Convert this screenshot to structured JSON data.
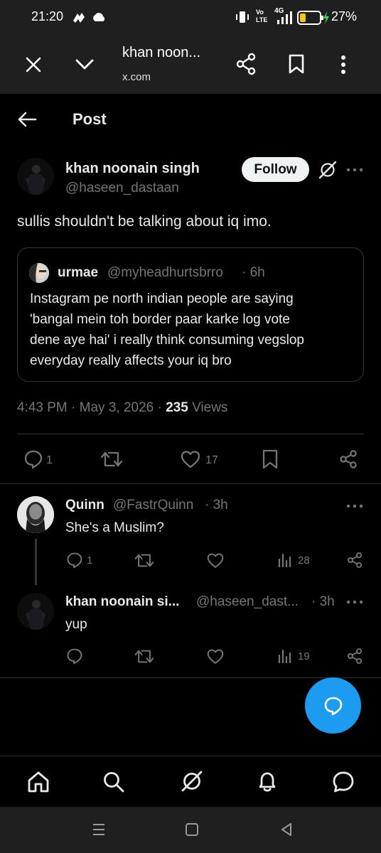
{
  "status_bar": {
    "time": "21:20",
    "battery_pct": "27%",
    "network": "4G",
    "volte": "Vo LTE"
  },
  "browser": {
    "page_title": "khan noon...",
    "url": "x.com"
  },
  "header": {
    "title": "Post"
  },
  "post": {
    "author_name": "khan noonain singh",
    "author_handle": "@haseen_dastaan",
    "follow_label": "Follow",
    "text": "sullis shouldn't be talking about iq imo.",
    "quote": {
      "author_name": "urmae",
      "author_handle": "@myheadhurtsbrro",
      "time": "· 6h",
      "lines": [
        "Instagram pe north indian people are saying",
        "'bangal mein toh border paar karke log vote",
        "dene aye hai' i really think consuming vegslop",
        "everyday really affects your iq bro"
      ]
    },
    "timestamp": "4:43 PM · May 3, 2026 ·",
    "views_count": "235",
    "views_label": "Views",
    "replies": "1",
    "likes": "17"
  },
  "replies": [
    {
      "name": "Quinn",
      "handle": "@FastrQuinn",
      "time": "· 3h",
      "text": "She's a Muslim?",
      "replies": "1",
      "views": "28"
    },
    {
      "name": "khan noonain si...",
      "handle": "@haseen_dast...",
      "time": "· 3h",
      "text": "yup",
      "views": "19"
    }
  ],
  "colors": {
    "accent": "#1d9bf0",
    "background": "#000000",
    "muted": "#71767b",
    "text": "#e7e9ea"
  }
}
